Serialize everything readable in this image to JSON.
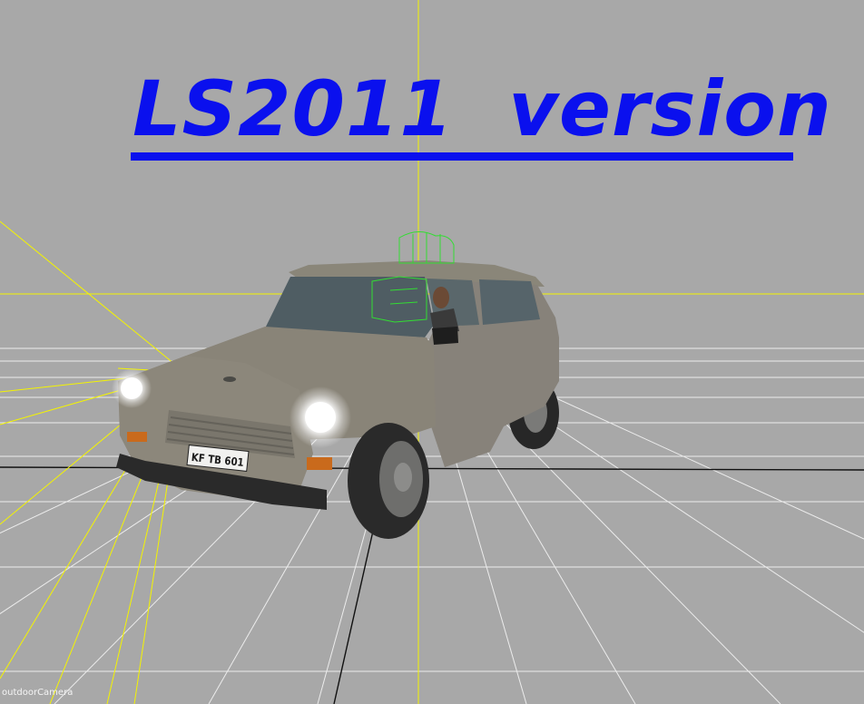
{
  "overlay": {
    "title": "LS2011  version",
    "title_color": "#0a10ee"
  },
  "viewport": {
    "camera_label": "outdoorCamera",
    "background_color": "#a8a8a8",
    "grid_color": "#ececec",
    "light_ray_color": "#f4f400",
    "axis_color": "#111111"
  },
  "vehicle": {
    "license_plate": "KF TB 601",
    "body_color": "#898478",
    "selection_color": "#33dd33"
  }
}
